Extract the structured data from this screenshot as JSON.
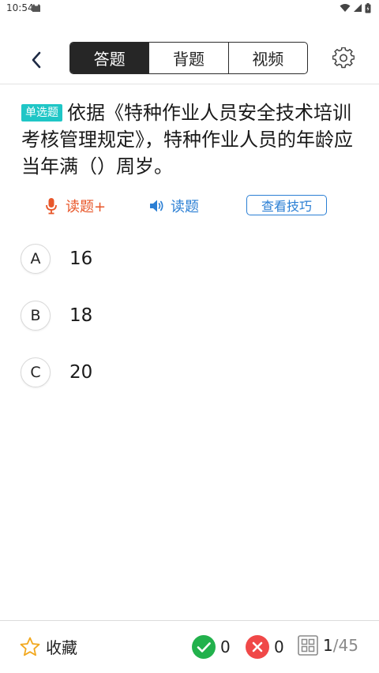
{
  "status_bar": {
    "time": "10:54"
  },
  "header": {
    "tabs": [
      {
        "label": "答题",
        "active": true
      },
      {
        "label": "背题",
        "active": false
      },
      {
        "label": "视频",
        "active": false
      }
    ]
  },
  "question": {
    "type_label": "单选题",
    "text": "依据《特种作业人员安全技术培训考核管理规定》，特种作业人员的年龄应当年满（）周岁。"
  },
  "tools": {
    "read_plus_label": "读题+",
    "read_label": "读题",
    "tips_label": "查看技巧"
  },
  "options": [
    {
      "letter": "A",
      "text": "16"
    },
    {
      "letter": "B",
      "text": "18"
    },
    {
      "letter": "C",
      "text": "20"
    }
  ],
  "bottom": {
    "favorite_label": "收藏",
    "correct_count": "0",
    "wrong_count": "0",
    "current": "1",
    "total": "/45"
  },
  "colors": {
    "badge": "#1fc6c6",
    "accent_orange": "#e8572a",
    "accent_blue": "#2b7fd4",
    "correct": "#22b14c",
    "wrong": "#f04848",
    "star": "#f2a81e"
  }
}
